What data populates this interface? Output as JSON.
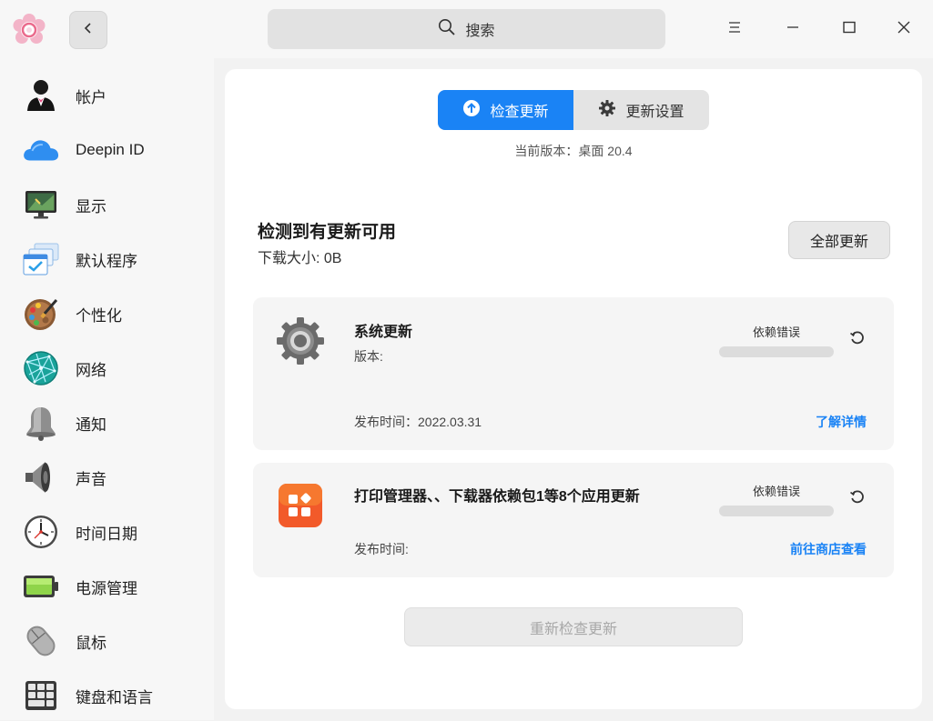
{
  "titlebar": {
    "app_icon": "settings-flower-icon",
    "back_icon": "chevron-left-icon",
    "search_placeholder": "搜索",
    "window_controls": [
      "menu-icon",
      "minimize-icon",
      "maximize-icon",
      "close-icon"
    ]
  },
  "sidebar": {
    "items": [
      {
        "label": "帐户",
        "icon": "account-icon"
      },
      {
        "label": "Deepin ID",
        "icon": "cloud-icon"
      },
      {
        "label": "显示",
        "icon": "display-icon"
      },
      {
        "label": "默认程序",
        "icon": "default-apps-icon"
      },
      {
        "label": "个性化",
        "icon": "palette-icon"
      },
      {
        "label": "网络",
        "icon": "network-globe-icon"
      },
      {
        "label": "通知",
        "icon": "bell-icon"
      },
      {
        "label": "声音",
        "icon": "speaker-icon"
      },
      {
        "label": "时间日期",
        "icon": "clock-icon"
      },
      {
        "label": "电源管理",
        "icon": "battery-icon"
      },
      {
        "label": "鼠标",
        "icon": "mouse-icon"
      },
      {
        "label": "键盘和语言",
        "icon": "keyboard-icon"
      }
    ]
  },
  "main": {
    "tabs": [
      {
        "label": "检查更新",
        "icon": "upload-circle-icon",
        "active": true
      },
      {
        "label": "更新设置",
        "icon": "gear-icon",
        "active": false
      }
    ],
    "current_version": "当前版本：桌面 20.4",
    "updates_title": "检测到有更新可用",
    "download_size": "下载大小: 0B",
    "update_all_label": "全部更新",
    "cards": [
      {
        "name": "系统更新",
        "version": "版本:",
        "release_date": "发布时间：2022.03.31",
        "status": "依赖错误",
        "link": "了解详情",
        "icon": "system-gear-icon"
      },
      {
        "name": "打印管理器、、下载器依赖包1等8个应用更新",
        "release_date": "发布时间:",
        "status": "依赖错误",
        "link": "前往商店查看",
        "icon": "app-store-icon"
      }
    ],
    "recheck_label": "重新检查更新",
    "accent_color": "#1a83f5"
  }
}
